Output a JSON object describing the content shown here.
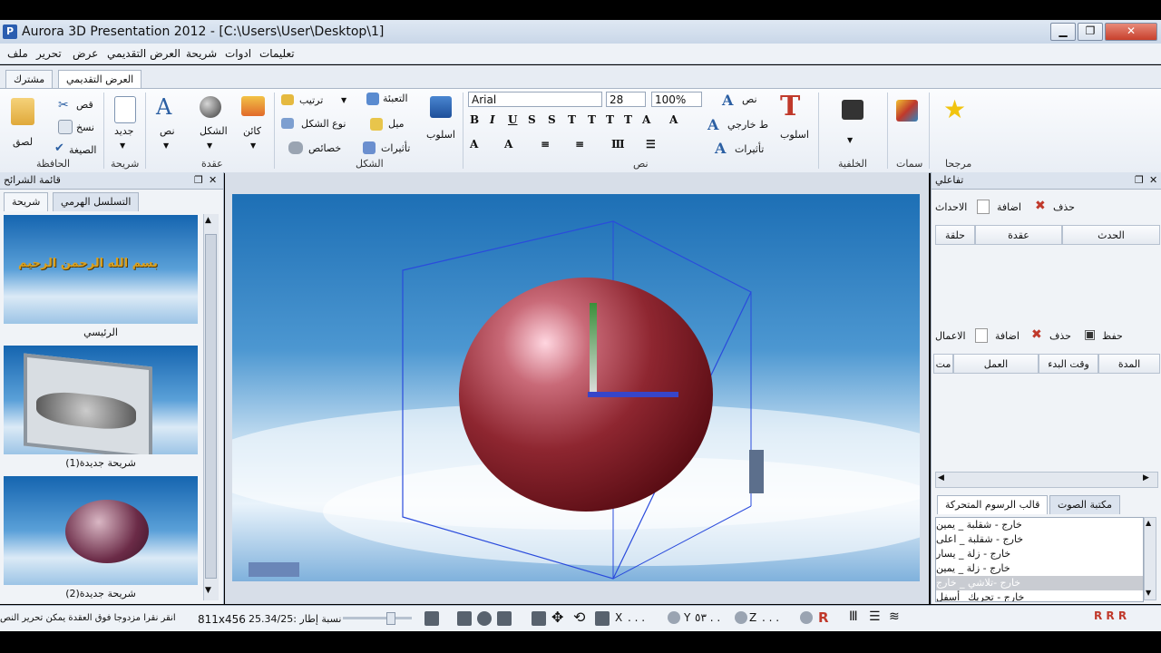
{
  "window": {
    "title": "Aurora 3D Presentation 2012 - [C:\\Users\\User\\Desktop\\1]",
    "app_icon": "P",
    "minimize": "▁",
    "restore": "❐",
    "close": "✕"
  },
  "menu": [
    "تعليمات",
    "ادوات",
    "شريحة",
    "العرض التقديمي",
    "عرض",
    "تحرير",
    "ملف"
  ],
  "tabs": {
    "common": "مشترك",
    "presentation": "العرض التقديمي"
  },
  "ribbon": {
    "clipboard": {
      "label": "الحافظة",
      "paste": "لصق",
      "cut": "قص",
      "copy": "نسخ",
      "format": "الصيغة"
    },
    "slide": {
      "label": "شريحة",
      "new": "جديد"
    },
    "node": {
      "label": "عقدة",
      "text": "نص",
      "shape": "الشكل",
      "object": "كائن"
    },
    "shape": {
      "label": "الشكل",
      "order": "ترتيب",
      "shape_type": "نوع الشكل",
      "properties": "خصائص",
      "fill": "التعبئة",
      "tilt": "ميل",
      "effects": "تأثيرات",
      "style": "اسلوب"
    },
    "text": {
      "label": "نص",
      "font": "Arial",
      "size": "28",
      "zoom": "100%",
      "text": "نص",
      "outline": "ط خارجي",
      "effects": "تأثيرات",
      "style": "اسلوب"
    },
    "background": {
      "label": "الخلفية"
    },
    "themes": {
      "label": "سمات"
    },
    "favorites": {
      "label": "مرجحا"
    }
  },
  "slides_panel": {
    "title": "قائمة الشرائح",
    "tab_hierarchy": "التسلسل الهرمي",
    "tab_slide": "شريحة",
    "thumb1_text": "بسم الله الرحمن الرحيم",
    "slides": [
      {
        "label": "الرئيسي"
      },
      {
        "label": "(شريحة جديدة(1"
      },
      {
        "label": "(شريحة جديدة(2"
      }
    ]
  },
  "interaction_panel": {
    "title": "تفاعلي",
    "events_label": "الاحداث",
    "add": "اضافة",
    "delete": "حذف",
    "save": "حفظ",
    "events_columns": [
      "الحدث",
      "عقدة",
      "حلقة"
    ],
    "actions_label": "الاعمال",
    "actions_columns": [
      "المدة",
      "وقت البدء",
      "العمل",
      "مت"
    ],
    "tab_sound": "مكتبة الصوت",
    "tab_animation": "قالب الرسوم المتحركة",
    "animations": [
      "خارج - شقلبة _ يمين",
      "خارج - شقلبة _ اعلى",
      "خارج - زلة _ يسار",
      "خارج - زلة _ يمين",
      "خارج -تلاشي _ خارج",
      "خارج - تحريك_ أسفل"
    ],
    "selected_index": 4
  },
  "status": {
    "hint": "انقر نقرا مزدوجا فوق العقدة يمكن تحرير النص",
    "frame_rate": "نسبة إطار :25.34/25",
    "resolution": "811x456",
    "x_label": "X",
    "x_value": ". . .",
    "y_label": "Y",
    "y_value": "٥٣ . .",
    "z_label": "Z",
    "z_value": ". . ."
  }
}
